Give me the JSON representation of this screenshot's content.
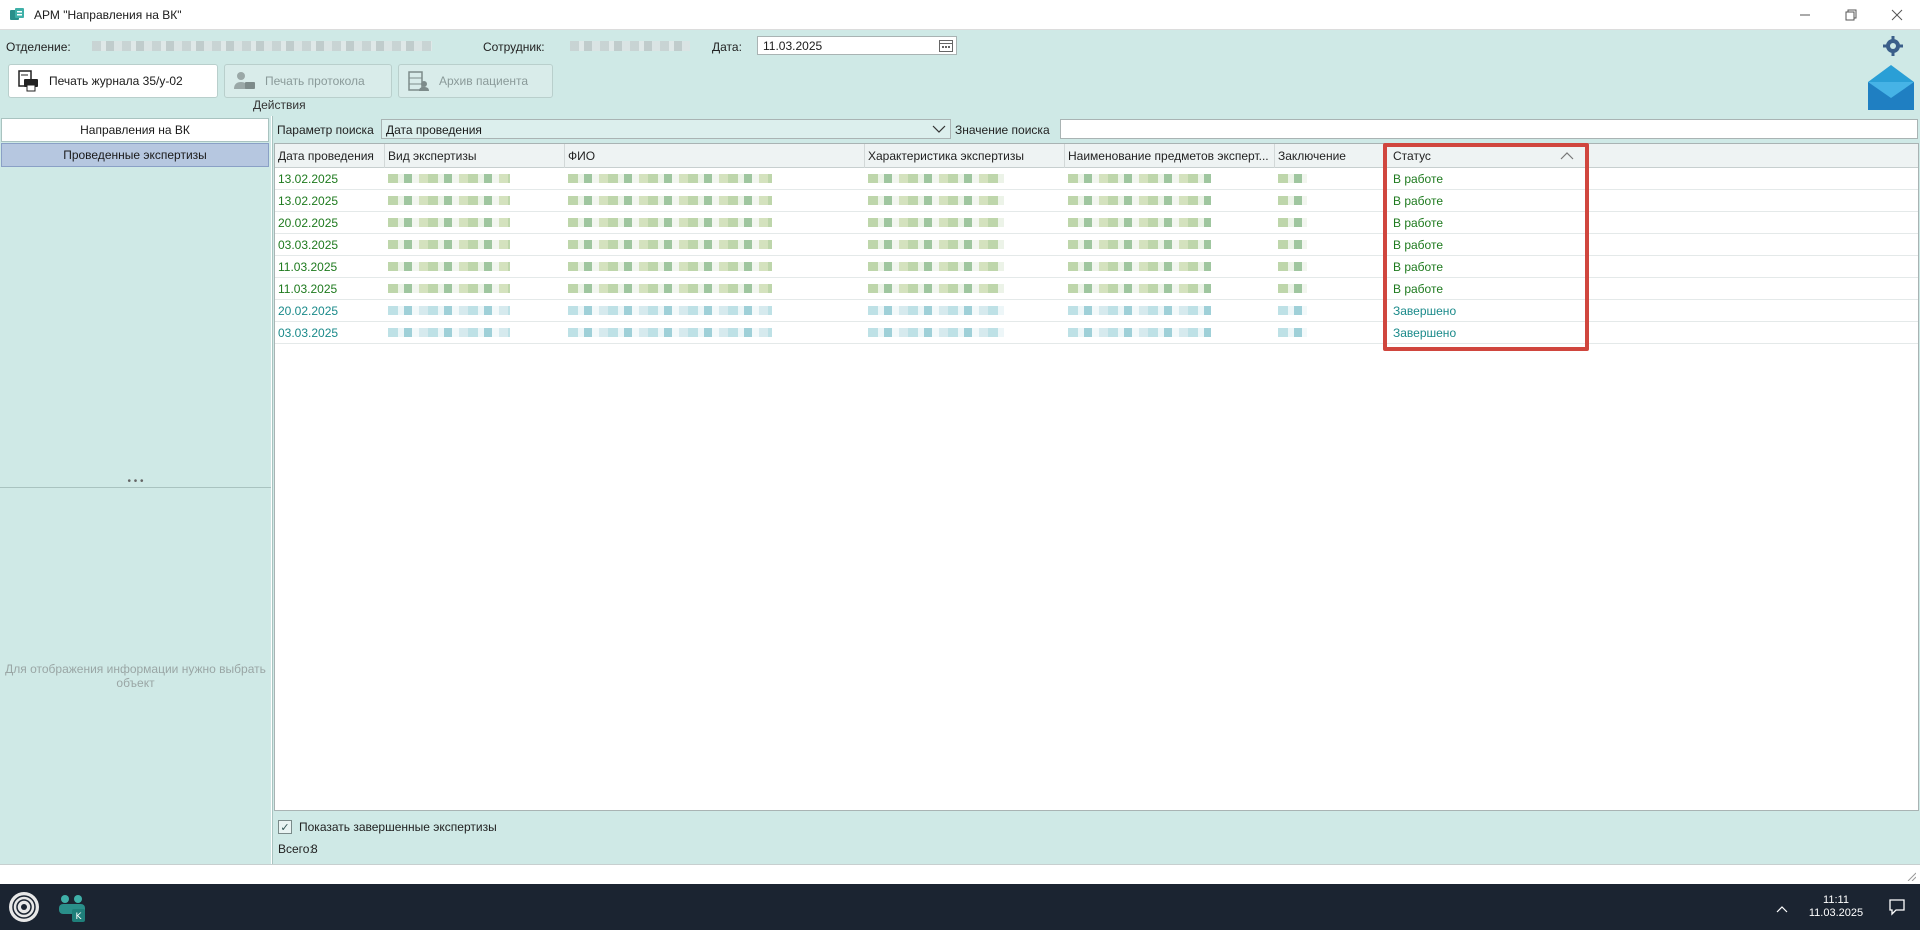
{
  "window": {
    "title": "АРМ \"Направления на ВК\""
  },
  "topbar": {
    "department_label": "Отделение:",
    "employee_label": "Сотрудник:",
    "date_label": "Дата:",
    "date_value": "11.03.2025",
    "actions_group_label": "Действия",
    "buttons": [
      {
        "label": "Печать журнала 35/у-02",
        "enabled": true,
        "icon": "printer-journal-icon"
      },
      {
        "label": "Печать протокола",
        "enabled": false,
        "icon": "print-protocol-icon"
      },
      {
        "label": "Архив пациента",
        "enabled": false,
        "icon": "patient-archive-icon"
      }
    ]
  },
  "sidebar": {
    "items": [
      {
        "label": "Направления на ВК",
        "active": false
      },
      {
        "label": "Проведенные экспертизы",
        "active": true
      }
    ],
    "info_text": "Для отображения информации нужно выбрать объект"
  },
  "search": {
    "param_label": "Параметр поиска",
    "param_value": "Дата проведения",
    "value_label": "Значение поиска",
    "value": ""
  },
  "table": {
    "columns": [
      "Дата проведения",
      "Вид экспертизы",
      "ФИО",
      "Характеристика экспертизы",
      "Наименование предметов эксперт...",
      "Заключение",
      "Статус"
    ],
    "rows": [
      {
        "date": "13.02.2025",
        "status": "В работе",
        "color": "green"
      },
      {
        "date": "13.02.2025",
        "status": "В работе",
        "color": "green"
      },
      {
        "date": "20.02.2025",
        "status": "В работе",
        "color": "green"
      },
      {
        "date": "03.03.2025",
        "status": "В работе",
        "color": "green"
      },
      {
        "date": "11.03.2025",
        "status": "В работе",
        "color": "green"
      },
      {
        "date": "11.03.2025",
        "status": "В работе",
        "color": "green"
      },
      {
        "date": "20.02.2025",
        "status": "Завершено",
        "color": "teal"
      },
      {
        "date": "03.03.2025",
        "status": "Завершено",
        "color": "teal"
      }
    ]
  },
  "footer": {
    "show_completed_label": "Показать завершенные экспертизы",
    "show_completed_checked": true,
    "total_label": "Всего:",
    "total_value": "8"
  },
  "taskbar": {
    "time": "11:11",
    "date": "11.03.2025"
  },
  "colors": {
    "accent_bg": "#cfe9e6",
    "status_green": "#1e7a1e",
    "status_teal": "#1a8a8a",
    "highlight": "#d0463e"
  }
}
